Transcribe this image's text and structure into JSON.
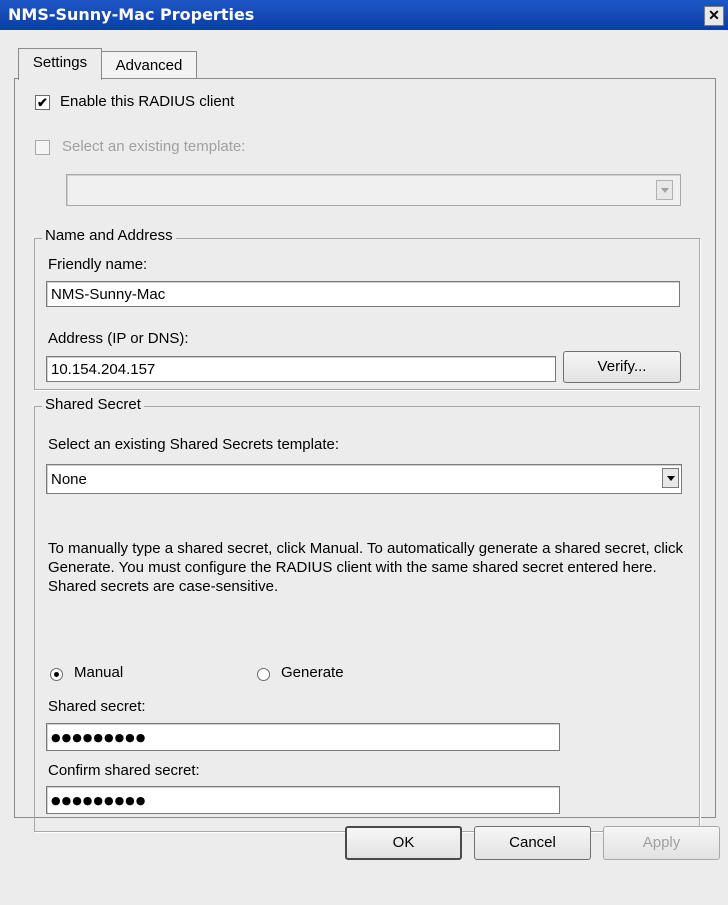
{
  "window": {
    "title": "NMS-Sunny-Mac Properties",
    "close_glyph": "✕"
  },
  "tabs": [
    {
      "label": "Settings",
      "active": true
    },
    {
      "label": "Advanced",
      "active": false
    }
  ],
  "settings": {
    "enable_client": {
      "label": "Enable this RADIUS client",
      "checked": true,
      "glyph": "✔"
    },
    "select_template": {
      "label": "Select an existing template:",
      "checked": false,
      "disabled": true
    },
    "template_value": ""
  },
  "name_address": {
    "legend": "Name and Address",
    "friendly_name_label": "Friendly name:",
    "friendly_name_value": "NMS-Sunny-Mac",
    "address_label": "Address (IP or DNS):",
    "address_value": "10.154.204.157",
    "verify_button": "Verify..."
  },
  "shared_secret": {
    "legend": "Shared Secret",
    "template_label": "Select an existing Shared Secrets template:",
    "template_value": "None",
    "info_text": "To manually type a shared secret, click Manual. To automatically generate a shared secret, click Generate. You must configure the RADIUS client with the same shared secret entered here. Shared secrets are case-sensitive.",
    "mode_options": [
      {
        "label": "Manual",
        "selected": true
      },
      {
        "label": "Generate",
        "selected": false
      }
    ],
    "secret_label": "Shared secret:",
    "secret_mask": "●●●●●●●●●",
    "confirm_label": "Confirm shared secret:",
    "confirm_mask": "●●●●●●●●●"
  },
  "footer": {
    "ok_label": "OK",
    "cancel_label": "Cancel",
    "apply_label": "Apply"
  },
  "colors": {
    "titlebar": "#0a3ea8",
    "dialog_bg": "#ececec",
    "disabled_text": "#a0a0a0"
  }
}
